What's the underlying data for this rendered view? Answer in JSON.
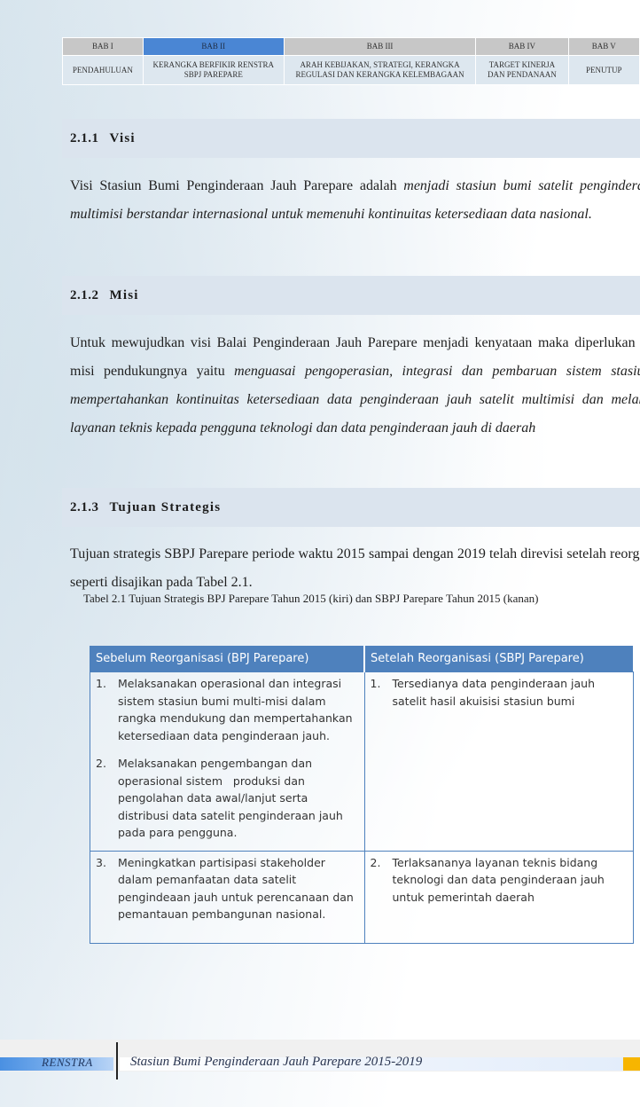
{
  "chapter_nav": {
    "chapters": [
      {
        "id": "BAB I",
        "title": "PENDAHULUAN",
        "active": false
      },
      {
        "id": "BAB II",
        "title": "KERANGKA BERFIKIR RENSTRA SBPJ PAREPARE",
        "active": true
      },
      {
        "id": "BAB III",
        "title": "ARAH KEBIJAKAN, STRATEGI, KERANGKA REGULASI DAN KERANGKA KELEMBAGAAN",
        "active": false
      },
      {
        "id": "BAB IV",
        "title": "TARGET KINERJA DAN PENDANAAN",
        "active": false
      },
      {
        "id": "BAB V",
        "title": "PENUTUP",
        "active": false
      }
    ],
    "active_color": "#4a86d4",
    "inactive_color": "#c7c7c7"
  },
  "sections": [
    {
      "number": "2.1.1",
      "title": "Visi",
      "paragraph": {
        "plain": "Visi Stasiun Bumi Penginderaan Jauh Parepare adalah ",
        "italic": "menjadi stasiun bumi satelit penginderaan jauh multimisi berstandar internasional untuk memenuhi kontinuitas ketersediaan data nasional."
      }
    },
    {
      "number": "2.1.2",
      "title": "Misi",
      "paragraph": {
        "plain": "Untuk mewujudkan visi Balai Penginderaan Jauh Parepare menjadi kenyataan maka diperlukan beberapa misi pendukungnya yaitu ",
        "italic": "menguasai pengoperasian, integrasi dan pembaruan sistem stasiun bumi, mempertahankan kontinuitas ketersediaan data penginderaan jauh satelit multimisi dan melaksanakan layanan teknis kepada pengguna teknologi dan data penginderaan jauh di daerah"
      }
    },
    {
      "number": "2.1.3",
      "title": "Tujuan Strategis",
      "paragraph": {
        "plain": "Tujuan strategis SBPJ Parepare periode waktu 2015 sampai dengan 2019 telah direvisi setelah reorganisasi seperti disajikan pada Tabel 2.1.",
        "italic": ""
      }
    }
  ],
  "table": {
    "caption": "Tabel 2.1 Tujuan Strategis BPJ Parepare Tahun 2015 (kiri) dan SBPJ Parepare Tahun 2015 (kanan)",
    "headers": [
      "Sebelum Reorganisasi (BPJ Parepare)",
      "Setelah Reorganisasi (SBPJ Parepare)"
    ],
    "header_color": "#4e81bd",
    "rows": [
      {
        "left": [
          {
            "n": "1.",
            "text": "Melaksanakan operasional dan integrasi sistem stasiun bumi multi-misi dalam rangka mendukung dan mempertahankan ketersediaan data penginderaan jauh."
          },
          {
            "n": "2.",
            "text": "Melaksanakan pengembangan dan operasional sistem   produksi dan pengolahan data awal/lanjut serta distribusi data satelit penginderaan jauh pada para pengguna."
          }
        ],
        "right": [
          {
            "n": "1.",
            "text": "Tersedianya data penginderaan jauh satelit hasil akuisisi stasiun bumi"
          }
        ]
      },
      {
        "left": [
          {
            "n": "3.",
            "text": "Meningkatkan partisipasi stakeholder dalam pemanfaatan data satelit pengindeaan jauh untuk perencanaan dan pemantauan pembangunan nasional."
          }
        ],
        "right": [
          {
            "n": "2.",
            "text": "Terlaksananya layanan teknis bidang teknologi dan data penginderaan jauh untuk pemerintah daerah"
          }
        ]
      }
    ]
  },
  "footer": {
    "label": "RENSTRA",
    "title": "Stasiun Bumi Penginderaan Jauh Parepare 2015-2019",
    "accent_color": "#f7b500"
  }
}
